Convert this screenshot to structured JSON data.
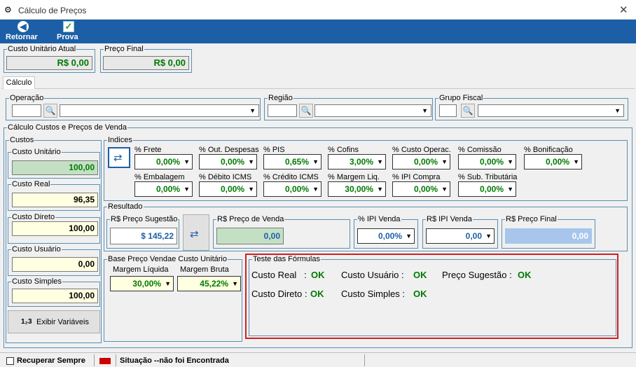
{
  "window": {
    "title": "Cálculo de Preços",
    "close": "✕"
  },
  "toolbar": {
    "back_label": "Retornar",
    "test_label": "Prova"
  },
  "summary": {
    "unit_cost_label": "Custo Unitário Atual",
    "unit_cost_value": "R$ 0,00",
    "final_price_label": "Preço Final",
    "final_price_value": "R$ 0,00"
  },
  "tab": {
    "label": "Cálculo"
  },
  "filters": {
    "operation_label": "Operação",
    "region_label": "Região",
    "fiscal_group_label": "Grupo Fiscal"
  },
  "calc": {
    "title": "Cálculo Custos e Preços de Venda"
  },
  "costs": {
    "title": "Custos",
    "unit_label": "Custo Unitário",
    "unit_value": "100,00",
    "real_label": "Custo Real",
    "real_value": "96,35",
    "direct_label": "Custo Direto",
    "direct_value": "100,00",
    "user_label": "Custo Usuário",
    "user_value": "0,00",
    "simple_label": "Custo Simples",
    "simple_value": "100,00",
    "vars_button": "Exibir Variáveis"
  },
  "indices": {
    "title": "Indices",
    "row1": [
      {
        "label": "% Frete",
        "value": "0,00%"
      },
      {
        "label": "% Out. Despesas",
        "value": "0,00%"
      },
      {
        "label": "% PIS",
        "value": "0,65%"
      },
      {
        "label": "% Cofins",
        "value": "3,00%"
      },
      {
        "label": "% Custo Operac.",
        "value": "0,00%"
      },
      {
        "label": "% Comissão",
        "value": "0,00%"
      },
      {
        "label": "% Bonificação",
        "value": "0,00%"
      }
    ],
    "row2": [
      {
        "label": "% Embalagem",
        "value": "0,00%"
      },
      {
        "label": "% Débito ICMS",
        "value": "0,00%"
      },
      {
        "label": "% Crédito ICMS",
        "value": "0,00%"
      },
      {
        "label": "% Margem Liq.",
        "value": "30,00%"
      },
      {
        "label": "% IPI Compra",
        "value": "0,00%"
      },
      {
        "label": "% Sub. Tributária",
        "value": "0,00%"
      }
    ]
  },
  "result": {
    "title": "Resultado",
    "suggested_label": "R$ Preço Sugestão",
    "suggested_value": "$ 145,22",
    "sale_label": "R$ Preço de Venda",
    "sale_value": "0,00",
    "ipi_pct_label": "% IPI Venda",
    "ipi_pct_value": "0,00%",
    "ipi_rs_label": "R$ IPI Venda",
    "ipi_rs_value": "0,00",
    "final_label": "R$ Preço Final",
    "final_value": "0,00"
  },
  "base": {
    "title": "Base Preço Vendae Custo Unitário",
    "net_label": "Margem Líquida",
    "net_value": "30,00%",
    "gross_label": "Margem Bruta",
    "gross_value": "45,22%"
  },
  "tests": {
    "title": "Teste das Fórmulas",
    "items": [
      {
        "label": "Custo Real   :",
        "status": "OK"
      },
      {
        "label": "Custo Usuário :",
        "status": "OK"
      },
      {
        "label": "Preço Sugestão :",
        "status": "OK"
      },
      {
        "label": "Custo Direto :",
        "status": "OK"
      },
      {
        "label": "Custo Simples :",
        "status": "OK"
      }
    ]
  },
  "statusbar": {
    "recover_label": "Recuperar Sempre",
    "situation": "Situação --não foi Encontrada"
  },
  "colors": {
    "toolbar": "#1c5fa6",
    "ok_green": "#007a00",
    "highlight": "#d21f1f"
  }
}
